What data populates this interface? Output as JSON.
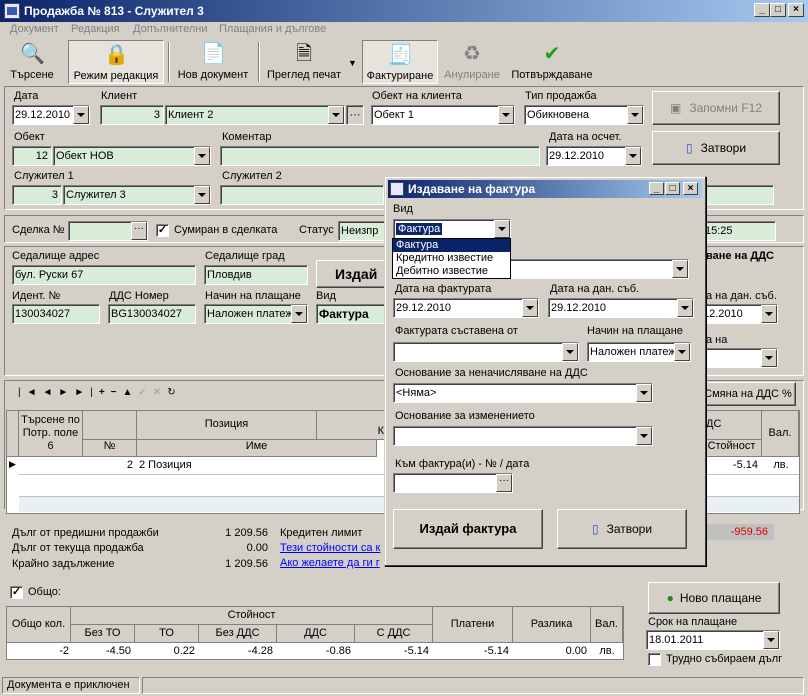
{
  "window": {
    "title": "Продажба № 813 - Служител 3"
  },
  "menu": [
    "Документ",
    "Редакция",
    "Допълнителни",
    "Плащания и дългове"
  ],
  "toolbar": [
    {
      "label": "Търсене",
      "icon": "magnifier-icon"
    },
    {
      "label": "Режим редакция",
      "icon": "lock-icon"
    },
    {
      "label": "Нов документ",
      "icon": "new-document-icon"
    },
    {
      "label": "Преглед печат",
      "icon": "print-preview-icon"
    },
    {
      "label": "Фактуриране",
      "icon": "invoice-icon"
    },
    {
      "label": "Анулиране",
      "icon": "recycle-bin-icon"
    },
    {
      "label": "Потвърждаване",
      "icon": "checkmark-icon"
    }
  ],
  "form": {
    "date_label": "Дата",
    "date": "29.12.2010",
    "client_label": "Клиент",
    "client_id": "3",
    "client_name": "Клиент 2",
    "client_obj_label": "Обект на клиента",
    "client_obj": "Обект 1",
    "sale_type_label": "Тип продажба",
    "sale_type": "Обикновена",
    "save_label": "Запомни  F12",
    "close_label": "Затвори",
    "object_label": "Обект",
    "object_id": "12",
    "object_name": "Обект НОВ",
    "comment_label": "Коментар",
    "acc_date_label": "Дата на осчет.",
    "acc_date": "29.12.2010",
    "emp1_label": "Служител 1",
    "emp1_id": "3",
    "emp1_name": "Служител 3",
    "emp2_label": "Служител 2",
    "deal_label": "Сделка №",
    "summed_label": "Сумиран в сделката",
    "status_label": "Статус",
    "status_value": "Неизпр",
    "time_value": "15:25"
  },
  "client_info": {
    "addr_label": "Седалище адрес",
    "addr": "бул. Руски 67",
    "city_label": "Седалище град",
    "city": "Пловдив",
    "issue_partial": "Издай",
    "id_label": "Идент. №",
    "id": "130034027",
    "vat_label": "ДДС Номер",
    "vat": "BG130034027",
    "pay_label": "Начин на плащане",
    "pay": "Наложен платеж",
    "kind_label": "Вид",
    "kind": "Фактура",
    "right_label1": "ване на ДДС",
    "right_label2": "а на дан. съб.",
    "right_date": "12.2010",
    "right_label3": "а на"
  },
  "items_grid": {
    "vat_change_label": "Смяна на ДДС %",
    "col_search": "Търсене по Потр. поле 6",
    "col_position": "Позиция",
    "col_no": "№",
    "col_name": "Име",
    "col_k": "К",
    "col_vat": "ДС",
    "col_value": "Стойност",
    "col_cur": "Вал.",
    "row": {
      "no": "2",
      "name": "2 Позиция",
      "value": "-5.14",
      "cur": "лв."
    }
  },
  "debts": {
    "prev_label": "Дълг от предишни продажби",
    "prev": "1 209.56",
    "cur_label": "Дълг от текуща продажба",
    "cur": "0.00",
    "total_label": "Крайно задължение",
    "total": "1 209.56",
    "credit_label": "Кредитен лимит",
    "link1": "Тези стойности са к",
    "link2": "Ако желаете да ги г",
    "red_value": "-959.56"
  },
  "totals": {
    "total_label": "Общо:",
    "qty_label": "Общо кол.",
    "value_label": "Стойност",
    "cols": [
      "Без ТО",
      "ТО",
      "Без ДДС",
      "ДДС",
      "С ДДС"
    ],
    "paid_label": "Платени",
    "diff_label": "Разлика",
    "cur_label": "Вал.",
    "qty": "-2",
    "values": [
      "-4.50",
      "0.22",
      "-4.28",
      "-0.86",
      "-5.14"
    ],
    "paid": "-5.14",
    "diff": "0.00",
    "cur": "лв.",
    "new_payment": "Ново плащане",
    "due_label": "Срок на плащане",
    "due": "18.01.2011",
    "hard_debt": "Трудно събираем дълг"
  },
  "status_bar": {
    "text": "Документа е приключен"
  },
  "dialog": {
    "title": "Издаване на фактура",
    "kind_label": "Вид",
    "kind": "Фактура",
    "kind_options": [
      "Фактура",
      "Кредитно известие",
      "Дебитно известие"
    ],
    "invoice_date_label": "Дата на фактурата",
    "invoice_date": "29.12.2010",
    "tax_date_label": "Дата на дан. съб.",
    "tax_date": "29.12.2010",
    "composed_label": "Фактурата съставена от",
    "pay_label": "Начин на плащане",
    "pay": "Наложен платеж",
    "no_vat_label": "Основание за неначисляване на ДДС",
    "no_vat": "<Няма>",
    "change_label": "Основание за изменението",
    "ref_label": "Към фактура(и) - № / дата",
    "issue_btn": "Издай фактура",
    "close_btn": "Затвори"
  }
}
